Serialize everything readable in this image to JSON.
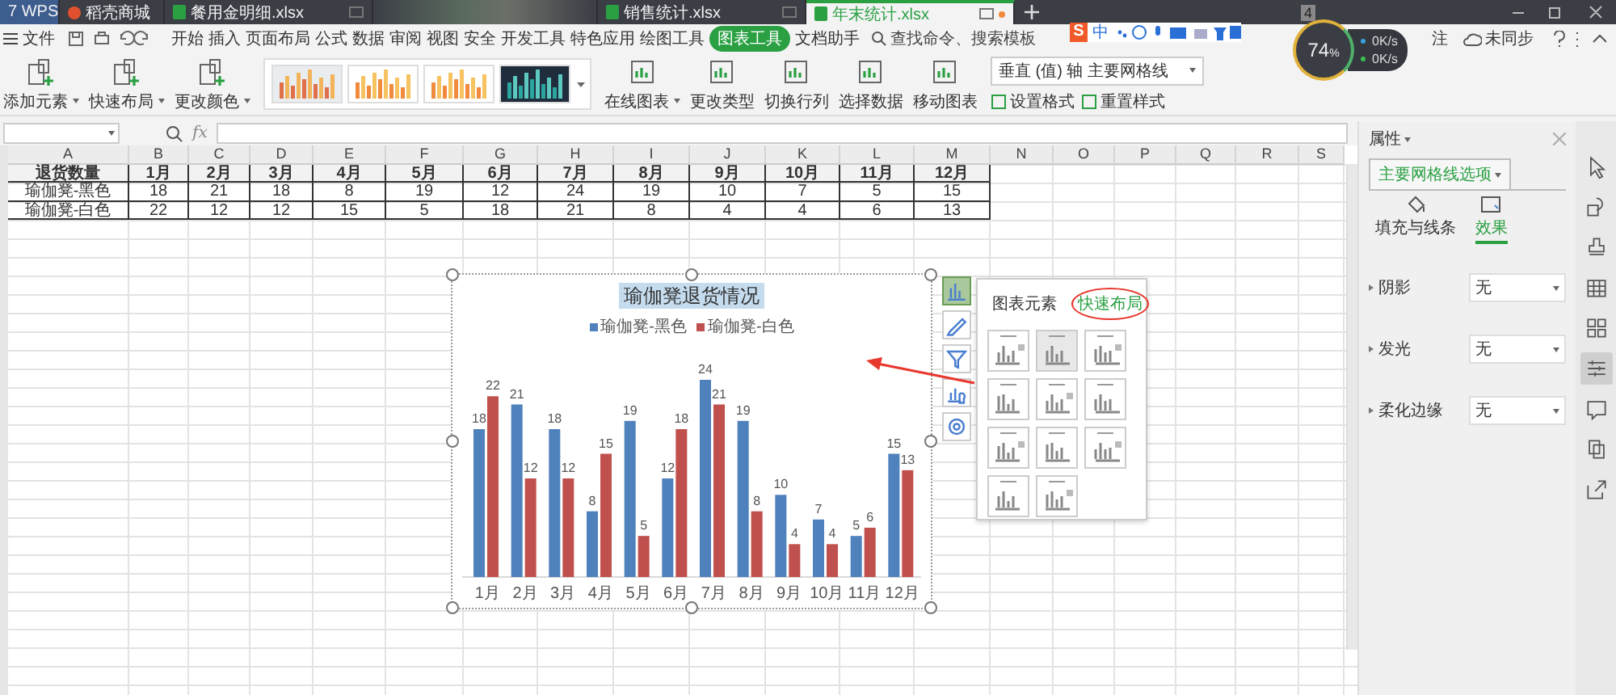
{
  "tabs": [
    {
      "label": "7 WPS",
      "kind": "home",
      "selected": false
    },
    {
      "label": "稻壳商城",
      "kind": "store",
      "selected": false
    },
    {
      "label": "餐用金明细.xlsx",
      "kind": "sheet",
      "selected": false
    },
    {
      "kind": "blurred",
      "selected": false
    },
    {
      "label": "销售统计.xlsx",
      "kind": "sheet",
      "selected": false
    },
    {
      "label": "年末统计.xlsx",
      "kind": "sheet",
      "selected": true
    }
  ],
  "tab_count": "4",
  "menu": {
    "file": "文件",
    "items": [
      {
        "label": "开始",
        "selected": false
      },
      {
        "label": "插入",
        "selected": false
      },
      {
        "label": "页面布局",
        "selected": false
      },
      {
        "label": "公式",
        "selected": false
      },
      {
        "label": "数据",
        "selected": false
      },
      {
        "label": "审阅",
        "selected": false
      },
      {
        "label": "视图",
        "selected": false
      },
      {
        "label": "安全",
        "selected": false
      },
      {
        "label": "开发工具",
        "selected": false
      },
      {
        "label": "特色应用",
        "selected": false
      },
      {
        "label": "绘图工具",
        "selected": false
      },
      {
        "label": "图表工具",
        "selected": true
      },
      {
        "label": "文档助手",
        "selected": false
      }
    ],
    "search_placeholder": "查找命令、搜索模板",
    "comment": "注",
    "sync": "未同步"
  },
  "ime": {
    "logo": "S",
    "mode": "中"
  },
  "speed_widget": {
    "percent": "74",
    "unit": "%",
    "upload": "0K/s",
    "download": "0K/s"
  },
  "ribbon": {
    "left_buttons": [
      {
        "label": "添加元素",
        "dropdown": true
      },
      {
        "label": "快速布局",
        "dropdown": true
      },
      {
        "label": "更改颜色",
        "dropdown": true
      }
    ],
    "right_buttons": [
      {
        "label": "在线图表",
        "dropdown": true
      },
      {
        "label": "更改类型",
        "dropdown": false
      },
      {
        "label": "切换行列",
        "dropdown": false
      },
      {
        "label": "选择数据",
        "dropdown": false
      },
      {
        "label": "移动图表",
        "dropdown": false
      }
    ],
    "element_select": "垂直 (值) 轴 主要网格线",
    "small_buttons": [
      {
        "label": "设置格式"
      },
      {
        "label": "重置样式"
      }
    ]
  },
  "formula_bar": {
    "fx": "fx"
  },
  "sheet": {
    "columns": [
      "A",
      "B",
      "C",
      "D",
      "E",
      "F",
      "G",
      "H",
      "I",
      "J",
      "K",
      "L",
      "M",
      "N",
      "O",
      "P",
      "Q",
      "R",
      "S"
    ],
    "table": {
      "header": [
        "退货数量",
        "1月",
        "2月",
        "3月",
        "4月",
        "5月",
        "6月",
        "7月",
        "8月",
        "9月",
        "10月",
        "11月",
        "12月"
      ],
      "rows": [
        [
          "瑜伽凳-黑色",
          "18",
          "21",
          "18",
          "8",
          "19",
          "12",
          "24",
          "19",
          "10",
          "7",
          "5",
          "15"
        ],
        [
          "瑜伽凳-白色",
          "22",
          "12",
          "12",
          "15",
          "5",
          "18",
          "21",
          "8",
          "4",
          "4",
          "6",
          "13"
        ]
      ]
    },
    "chart": {
      "chart_data": {
        "type": "bar",
        "title": "瑜伽凳退货情况",
        "categories": [
          "1月",
          "2月",
          "3月",
          "4月",
          "5月",
          "6月",
          "7月",
          "8月",
          "9月",
          "10月",
          "11月",
          "12月"
        ],
        "series": [
          {
            "name": "瑜伽凳-黑色",
            "color": "#4f81bd",
            "values": [
              18,
              21,
              18,
              8,
              19,
              12,
              24,
              19,
              10,
              7,
              5,
              15
            ]
          },
          {
            "name": "瑜伽凳-白色",
            "color": "#c0504d",
            "values": [
              22,
              12,
              12,
              15,
              5,
              18,
              21,
              8,
              4,
              4,
              6,
              13
            ]
          }
        ],
        "data_labels": true
      }
    },
    "chart_buttons": [
      {
        "selected": true
      },
      {
        "selected": false
      },
      {
        "selected": false
      },
      {
        "selected": false
      },
      {
        "selected": false
      }
    ],
    "popup": {
      "tabs": [
        {
          "label": "图表元素",
          "selected": false,
          "circled": false
        },
        {
          "label": "快速布局",
          "selected": true,
          "circled": true
        }
      ],
      "layouts": [
        {
          "selected": false
        },
        {
          "selected": true
        },
        {
          "selected": false
        },
        {
          "selected": false
        },
        {
          "selected": false
        },
        {
          "selected": false
        },
        {
          "selected": false
        },
        {
          "selected": false
        },
        {
          "selected": false
        },
        {
          "selected": false
        },
        {
          "selected": false
        }
      ]
    }
  },
  "panel": {
    "title": "属性",
    "tab": "主要网格线选项",
    "subtabs": [
      {
        "label": "填充与线条",
        "selected": false
      },
      {
        "label": "效果",
        "selected": true
      }
    ],
    "rows": [
      {
        "label": "阴影",
        "value": "无"
      },
      {
        "label": "发光",
        "value": "无"
      },
      {
        "label": "柔化边缘",
        "value": "无"
      }
    ]
  },
  "rail": [
    {
      "selected": false
    },
    {
      "selected": false
    },
    {
      "selected": false
    },
    {
      "selected": false
    },
    {
      "selected": false
    },
    {
      "selected": true
    },
    {
      "selected": false
    },
    {
      "selected": false
    },
    {
      "selected": false
    }
  ]
}
